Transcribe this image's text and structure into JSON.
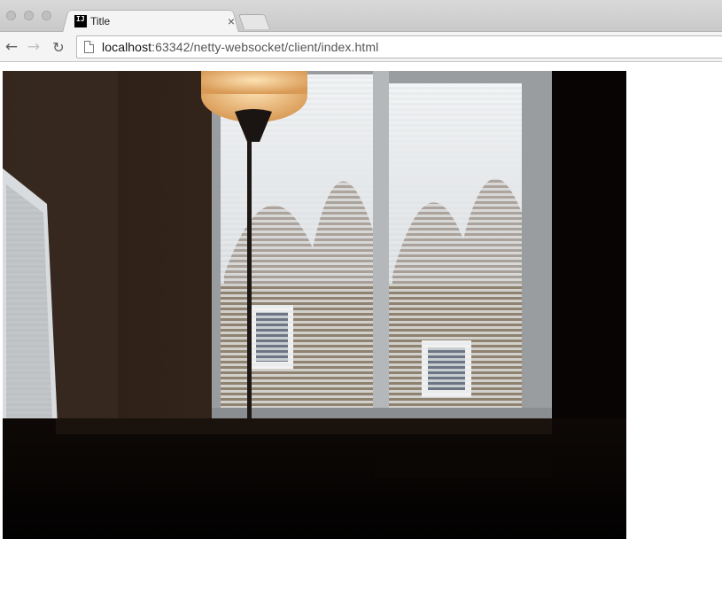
{
  "window": {
    "tab": {
      "title": "Title",
      "favicon_text": "IJ",
      "favicon_icon": "intellij-icon",
      "close_glyph": "×"
    }
  },
  "toolbar": {
    "back_glyph": "←",
    "forward_glyph": "→",
    "reload_glyph": "↻",
    "url": {
      "host": "localhost",
      "rest": ":63342/netty-websocket/client/index.html"
    }
  },
  "page": {
    "video_stream": {
      "description_icon": "webcam-frame",
      "colors": {
        "room": "#050302",
        "sky": "#dfe4ea",
        "lamp": "#f6c98d"
      }
    }
  }
}
